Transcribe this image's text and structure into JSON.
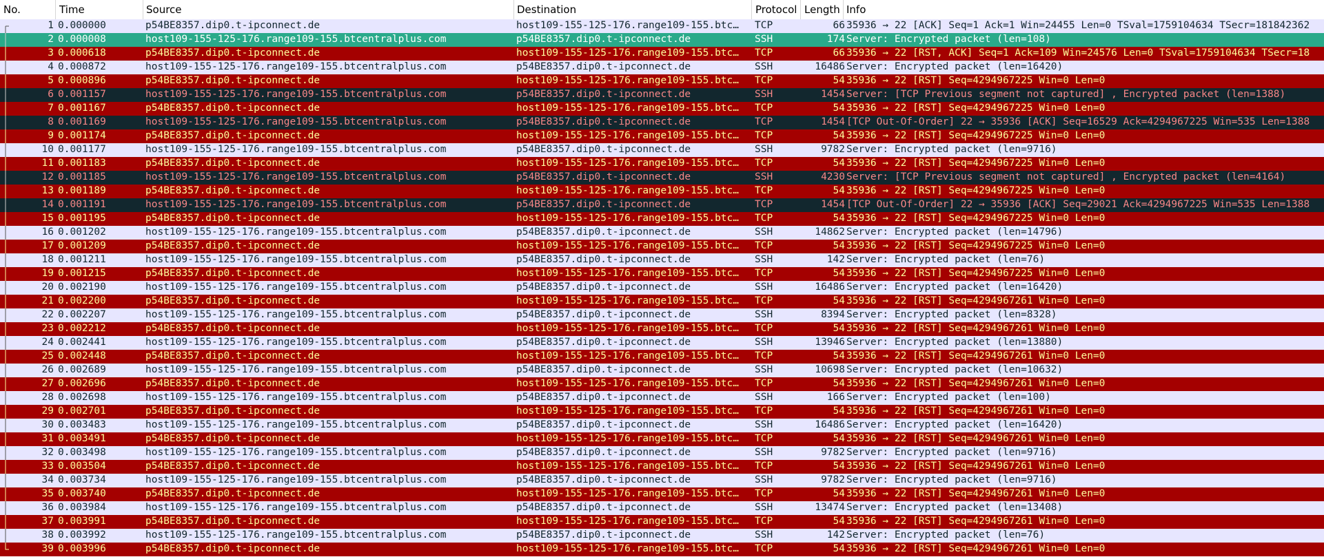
{
  "colors": {
    "lavender_bg": "#e7e6ff",
    "lavender_fg": "#12272e",
    "green_bg": "#2aaa8a",
    "green_fg": "#ffffff",
    "red_bg": "#a40000",
    "red_fg": "#fffc9c",
    "dark_bg": "#12272e",
    "dark_fg": "#f78787"
  },
  "columns": {
    "no": "No.",
    "time": "Time",
    "source": "Source",
    "destination": "Destination",
    "protocol": "Protocol",
    "length": "Length",
    "info": "Info"
  },
  "packets": [
    {
      "no": "1",
      "time": "0.000000",
      "source": "p54BE8357.dip0.t-ipconnect.de",
      "destination": "host109-155-125-176.range109-155.btc…",
      "protocol": "TCP",
      "length": "66",
      "info": "35936 → 22 [ACK] Seq=1 Ack=1 Win=24455 Len=0 TSval=1759104634 TSecr=181842362",
      "color": "lav"
    },
    {
      "no": "2",
      "time": "0.000008",
      "source": "host109-155-125-176.range109-155.btcentralplus.com",
      "destination": "p54BE8357.dip0.t-ipconnect.de",
      "protocol": "SSH",
      "length": "174",
      "info": "Server: Encrypted packet (len=108)",
      "color": "green"
    },
    {
      "no": "3",
      "time": "0.000618",
      "source": "p54BE8357.dip0.t-ipconnect.de",
      "destination": "host109-155-125-176.range109-155.btc…",
      "protocol": "TCP",
      "length": "66",
      "info": "35936 → 22 [RST, ACK] Seq=1 Ack=109 Win=24576 Len=0 TSval=1759104634 TSecr=18",
      "color": "red"
    },
    {
      "no": "4",
      "time": "0.000872",
      "source": "host109-155-125-176.range109-155.btcentralplus.com",
      "destination": "p54BE8357.dip0.t-ipconnect.de",
      "protocol": "SSH",
      "length": "16486",
      "info": "Server: Encrypted packet (len=16420)",
      "color": "lav"
    },
    {
      "no": "5",
      "time": "0.000896",
      "source": "p54BE8357.dip0.t-ipconnect.de",
      "destination": "host109-155-125-176.range109-155.btc…",
      "protocol": "TCP",
      "length": "54",
      "info": "35936 → 22 [RST] Seq=4294967225 Win=0 Len=0",
      "color": "red"
    },
    {
      "no": "6",
      "time": "0.001157",
      "source": "host109-155-125-176.range109-155.btcentralplus.com",
      "destination": "p54BE8357.dip0.t-ipconnect.de",
      "protocol": "SSH",
      "length": "1454",
      "info": "Server: [TCP Previous segment not captured] , Encrypted packet (len=1388)",
      "color": "dark"
    },
    {
      "no": "7",
      "time": "0.001167",
      "source": "p54BE8357.dip0.t-ipconnect.de",
      "destination": "host109-155-125-176.range109-155.btc…",
      "protocol": "TCP",
      "length": "54",
      "info": "35936 → 22 [RST] Seq=4294967225 Win=0 Len=0",
      "color": "red"
    },
    {
      "no": "8",
      "time": "0.001169",
      "source": "host109-155-125-176.range109-155.btcentralplus.com",
      "destination": "p54BE8357.dip0.t-ipconnect.de",
      "protocol": "TCP",
      "length": "1454",
      "info": "[TCP Out-Of-Order] 22 → 35936 [ACK] Seq=16529 Ack=4294967225 Win=535 Len=1388",
      "color": "dark"
    },
    {
      "no": "9",
      "time": "0.001174",
      "source": "p54BE8357.dip0.t-ipconnect.de",
      "destination": "host109-155-125-176.range109-155.btc…",
      "protocol": "TCP",
      "length": "54",
      "info": "35936 → 22 [RST] Seq=4294967225 Win=0 Len=0",
      "color": "red"
    },
    {
      "no": "10",
      "time": "0.001177",
      "source": "host109-155-125-176.range109-155.btcentralplus.com",
      "destination": "p54BE8357.dip0.t-ipconnect.de",
      "protocol": "SSH",
      "length": "9782",
      "info": "Server: Encrypted packet (len=9716)",
      "color": "lav"
    },
    {
      "no": "11",
      "time": "0.001183",
      "source": "p54BE8357.dip0.t-ipconnect.de",
      "destination": "host109-155-125-176.range109-155.btc…",
      "protocol": "TCP",
      "length": "54",
      "info": "35936 → 22 [RST] Seq=4294967225 Win=0 Len=0",
      "color": "red"
    },
    {
      "no": "12",
      "time": "0.001185",
      "source": "host109-155-125-176.range109-155.btcentralplus.com",
      "destination": "p54BE8357.dip0.t-ipconnect.de",
      "protocol": "SSH",
      "length": "4230",
      "info": "Server: [TCP Previous segment not captured] , Encrypted packet (len=4164)",
      "color": "dark"
    },
    {
      "no": "13",
      "time": "0.001189",
      "source": "p54BE8357.dip0.t-ipconnect.de",
      "destination": "host109-155-125-176.range109-155.btc…",
      "protocol": "TCP",
      "length": "54",
      "info": "35936 → 22 [RST] Seq=4294967225 Win=0 Len=0",
      "color": "red"
    },
    {
      "no": "14",
      "time": "0.001191",
      "source": "host109-155-125-176.range109-155.btcentralplus.com",
      "destination": "p54BE8357.dip0.t-ipconnect.de",
      "protocol": "TCP",
      "length": "1454",
      "info": "[TCP Out-Of-Order] 22 → 35936 [ACK] Seq=29021 Ack=4294967225 Win=535 Len=1388",
      "color": "dark"
    },
    {
      "no": "15",
      "time": "0.001195",
      "source": "p54BE8357.dip0.t-ipconnect.de",
      "destination": "host109-155-125-176.range109-155.btc…",
      "protocol": "TCP",
      "length": "54",
      "info": "35936 → 22 [RST] Seq=4294967225 Win=0 Len=0",
      "color": "red"
    },
    {
      "no": "16",
      "time": "0.001202",
      "source": "host109-155-125-176.range109-155.btcentralplus.com",
      "destination": "p54BE8357.dip0.t-ipconnect.de",
      "protocol": "SSH",
      "length": "14862",
      "info": "Server: Encrypted packet (len=14796)",
      "color": "lav"
    },
    {
      "no": "17",
      "time": "0.001209",
      "source": "p54BE8357.dip0.t-ipconnect.de",
      "destination": "host109-155-125-176.range109-155.btc…",
      "protocol": "TCP",
      "length": "54",
      "info": "35936 → 22 [RST] Seq=4294967225 Win=0 Len=0",
      "color": "red"
    },
    {
      "no": "18",
      "time": "0.001211",
      "source": "host109-155-125-176.range109-155.btcentralplus.com",
      "destination": "p54BE8357.dip0.t-ipconnect.de",
      "protocol": "SSH",
      "length": "142",
      "info": "Server: Encrypted packet (len=76)",
      "color": "lav"
    },
    {
      "no": "19",
      "time": "0.001215",
      "source": "p54BE8357.dip0.t-ipconnect.de",
      "destination": "host109-155-125-176.range109-155.btc…",
      "protocol": "TCP",
      "length": "54",
      "info": "35936 → 22 [RST] Seq=4294967225 Win=0 Len=0",
      "color": "red"
    },
    {
      "no": "20",
      "time": "0.002190",
      "source": "host109-155-125-176.range109-155.btcentralplus.com",
      "destination": "p54BE8357.dip0.t-ipconnect.de",
      "protocol": "SSH",
      "length": "16486",
      "info": "Server: Encrypted packet (len=16420)",
      "color": "lav"
    },
    {
      "no": "21",
      "time": "0.002200",
      "source": "p54BE8357.dip0.t-ipconnect.de",
      "destination": "host109-155-125-176.range109-155.btc…",
      "protocol": "TCP",
      "length": "54",
      "info": "35936 → 22 [RST] Seq=4294967261 Win=0 Len=0",
      "color": "red"
    },
    {
      "no": "22",
      "time": "0.002207",
      "source": "host109-155-125-176.range109-155.btcentralplus.com",
      "destination": "p54BE8357.dip0.t-ipconnect.de",
      "protocol": "SSH",
      "length": "8394",
      "info": "Server: Encrypted packet (len=8328)",
      "color": "lav"
    },
    {
      "no": "23",
      "time": "0.002212",
      "source": "p54BE8357.dip0.t-ipconnect.de",
      "destination": "host109-155-125-176.range109-155.btc…",
      "protocol": "TCP",
      "length": "54",
      "info": "35936 → 22 [RST] Seq=4294967261 Win=0 Len=0",
      "color": "red"
    },
    {
      "no": "24",
      "time": "0.002441",
      "source": "host109-155-125-176.range109-155.btcentralplus.com",
      "destination": "p54BE8357.dip0.t-ipconnect.de",
      "protocol": "SSH",
      "length": "13946",
      "info": "Server: Encrypted packet (len=13880)",
      "color": "lav"
    },
    {
      "no": "25",
      "time": "0.002448",
      "source": "p54BE8357.dip0.t-ipconnect.de",
      "destination": "host109-155-125-176.range109-155.btc…",
      "protocol": "TCP",
      "length": "54",
      "info": "35936 → 22 [RST] Seq=4294967261 Win=0 Len=0",
      "color": "red"
    },
    {
      "no": "26",
      "time": "0.002689",
      "source": "host109-155-125-176.range109-155.btcentralplus.com",
      "destination": "p54BE8357.dip0.t-ipconnect.de",
      "protocol": "SSH",
      "length": "10698",
      "info": "Server: Encrypted packet (len=10632)",
      "color": "lav"
    },
    {
      "no": "27",
      "time": "0.002696",
      "source": "p54BE8357.dip0.t-ipconnect.de",
      "destination": "host109-155-125-176.range109-155.btc…",
      "protocol": "TCP",
      "length": "54",
      "info": "35936 → 22 [RST] Seq=4294967261 Win=0 Len=0",
      "color": "red"
    },
    {
      "no": "28",
      "time": "0.002698",
      "source": "host109-155-125-176.range109-155.btcentralplus.com",
      "destination": "p54BE8357.dip0.t-ipconnect.de",
      "protocol": "SSH",
      "length": "166",
      "info": "Server: Encrypted packet (len=100)",
      "color": "lav"
    },
    {
      "no": "29",
      "time": "0.002701",
      "source": "p54BE8357.dip0.t-ipconnect.de",
      "destination": "host109-155-125-176.range109-155.btc…",
      "protocol": "TCP",
      "length": "54",
      "info": "35936 → 22 [RST] Seq=4294967261 Win=0 Len=0",
      "color": "red"
    },
    {
      "no": "30",
      "time": "0.003483",
      "source": "host109-155-125-176.range109-155.btcentralplus.com",
      "destination": "p54BE8357.dip0.t-ipconnect.de",
      "protocol": "SSH",
      "length": "16486",
      "info": "Server: Encrypted packet (len=16420)",
      "color": "lav"
    },
    {
      "no": "31",
      "time": "0.003491",
      "source": "p54BE8357.dip0.t-ipconnect.de",
      "destination": "host109-155-125-176.range109-155.btc…",
      "protocol": "TCP",
      "length": "54",
      "info": "35936 → 22 [RST] Seq=4294967261 Win=0 Len=0",
      "color": "red"
    },
    {
      "no": "32",
      "time": "0.003498",
      "source": "host109-155-125-176.range109-155.btcentralplus.com",
      "destination": "p54BE8357.dip0.t-ipconnect.de",
      "protocol": "SSH",
      "length": "9782",
      "info": "Server: Encrypted packet (len=9716)",
      "color": "lav"
    },
    {
      "no": "33",
      "time": "0.003504",
      "source": "p54BE8357.dip0.t-ipconnect.de",
      "destination": "host109-155-125-176.range109-155.btc…",
      "protocol": "TCP",
      "length": "54",
      "info": "35936 → 22 [RST] Seq=4294967261 Win=0 Len=0",
      "color": "red"
    },
    {
      "no": "34",
      "time": "0.003734",
      "source": "host109-155-125-176.range109-155.btcentralplus.com",
      "destination": "p54BE8357.dip0.t-ipconnect.de",
      "protocol": "SSH",
      "length": "9782",
      "info": "Server: Encrypted packet (len=9716)",
      "color": "lav"
    },
    {
      "no": "35",
      "time": "0.003740",
      "source": "p54BE8357.dip0.t-ipconnect.de",
      "destination": "host109-155-125-176.range109-155.btc…",
      "protocol": "TCP",
      "length": "54",
      "info": "35936 → 22 [RST] Seq=4294967261 Win=0 Len=0",
      "color": "red"
    },
    {
      "no": "36",
      "time": "0.003984",
      "source": "host109-155-125-176.range109-155.btcentralplus.com",
      "destination": "p54BE8357.dip0.t-ipconnect.de",
      "protocol": "SSH",
      "length": "13474",
      "info": "Server: Encrypted packet (len=13408)",
      "color": "lav"
    },
    {
      "no": "37",
      "time": "0.003991",
      "source": "p54BE8357.dip0.t-ipconnect.de",
      "destination": "host109-155-125-176.range109-155.btc…",
      "protocol": "TCP",
      "length": "54",
      "info": "35936 → 22 [RST] Seq=4294967261 Win=0 Len=0",
      "color": "red"
    },
    {
      "no": "38",
      "time": "0.003992",
      "source": "host109-155-125-176.range109-155.btcentralplus.com",
      "destination": "p54BE8357.dip0.t-ipconnect.de",
      "protocol": "SSH",
      "length": "142",
      "info": "Server: Encrypted packet (len=76)",
      "color": "lav"
    },
    {
      "no": "39",
      "time": "0.003996",
      "source": "p54BE8357.dip0.t-ipconnect.de",
      "destination": "host109-155-125-176.range109-155.btc…",
      "protocol": "TCP",
      "length": "54",
      "info": "35936 → 22 [RST] Seq=4294967261 Win=0 Len=0",
      "color": "red"
    }
  ]
}
